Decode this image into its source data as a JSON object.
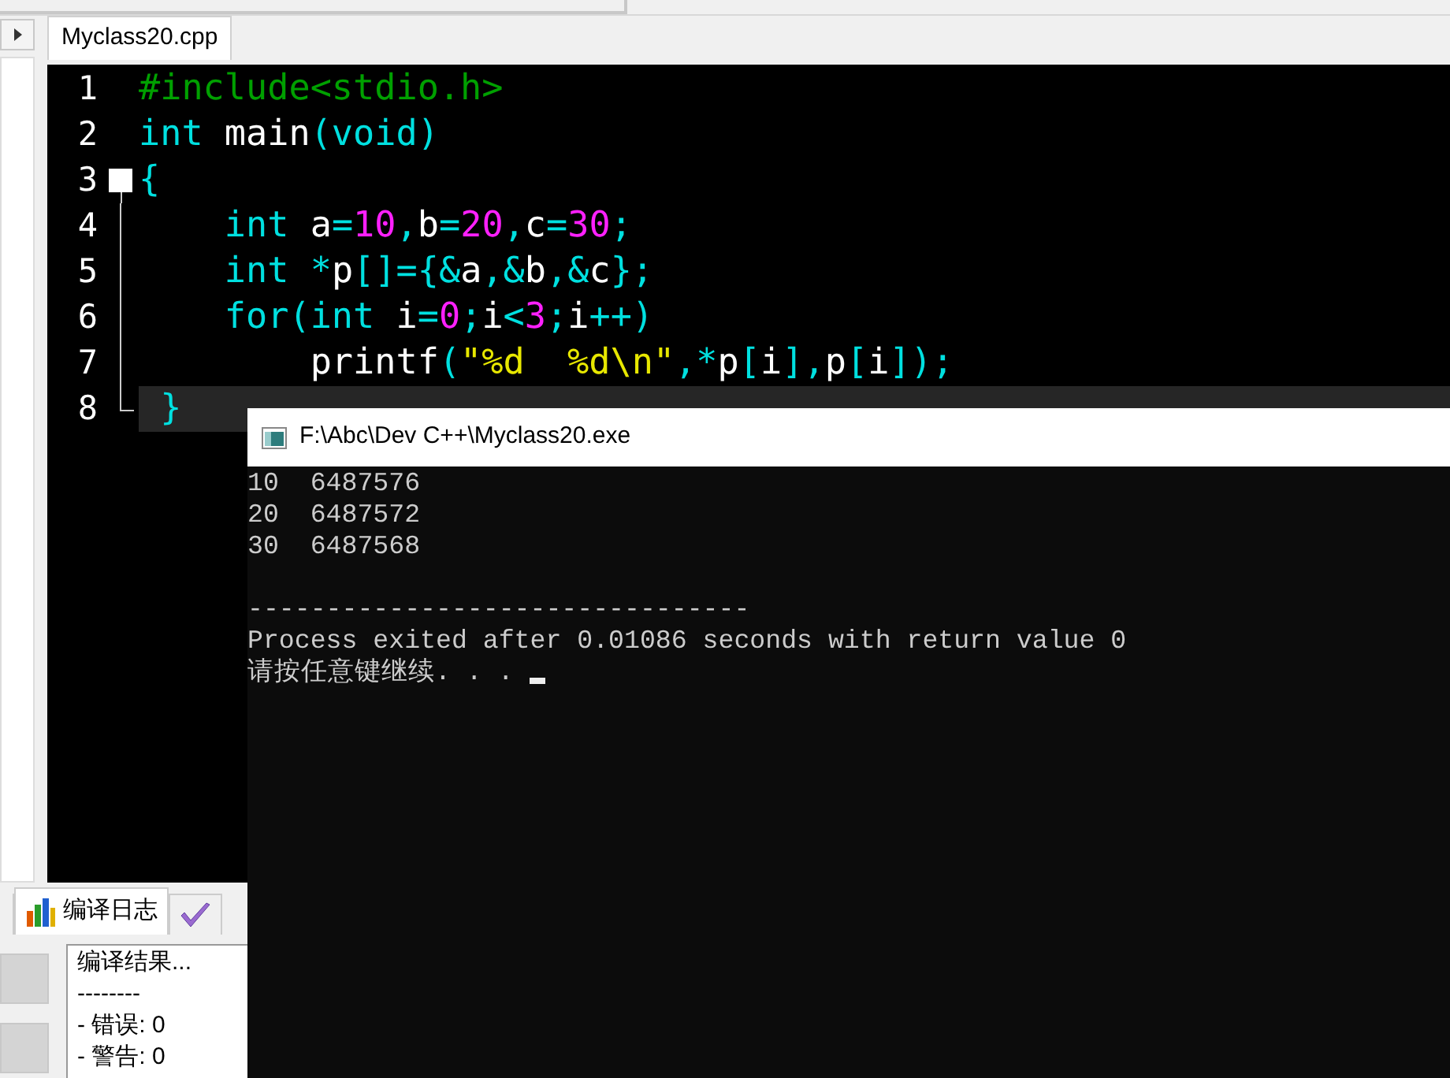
{
  "editor_tabs": [
    {
      "label": "Myclass20.cpp",
      "selected": true
    }
  ],
  "code_lines": [
    {
      "number": "1",
      "kind": "plain",
      "tokens": [
        {
          "text": "#include<stdio.h>",
          "kind": "pre"
        }
      ]
    },
    {
      "number": "2",
      "kind": "plain",
      "tokens": [
        {
          "text": "int",
          "kind": "kw"
        },
        {
          "text": " main",
          "kind": "id"
        },
        {
          "text": "(void)",
          "kind": "kw"
        }
      ]
    },
    {
      "number": "3",
      "kind": "fold_start",
      "tokens": [
        {
          "text": "{",
          "kind": "sym"
        }
      ]
    },
    {
      "number": "4",
      "kind": "in_fold",
      "tokens": [
        {
          "text": "    int",
          "kind": "kw"
        },
        {
          "text": " a",
          "kind": "id"
        },
        {
          "text": "=",
          "kind": "sym"
        },
        {
          "text": "10",
          "kind": "num"
        },
        {
          "text": ",",
          "kind": "sym"
        },
        {
          "text": "b",
          "kind": "id"
        },
        {
          "text": "=",
          "kind": "sym"
        },
        {
          "text": "20",
          "kind": "num"
        },
        {
          "text": ",",
          "kind": "sym"
        },
        {
          "text": "c",
          "kind": "id"
        },
        {
          "text": "=",
          "kind": "sym"
        },
        {
          "text": "30",
          "kind": "num"
        },
        {
          "text": ";",
          "kind": "sym"
        }
      ]
    },
    {
      "number": "5",
      "kind": "in_fold",
      "tokens": [
        {
          "text": "    int",
          "kind": "kw"
        },
        {
          "text": " *",
          "kind": "sym"
        },
        {
          "text": "p",
          "kind": "id"
        },
        {
          "text": "[]={&",
          "kind": "sym"
        },
        {
          "text": "a",
          "kind": "id"
        },
        {
          "text": ",&",
          "kind": "sym"
        },
        {
          "text": "b",
          "kind": "id"
        },
        {
          "text": ",&",
          "kind": "sym"
        },
        {
          "text": "c",
          "kind": "id"
        },
        {
          "text": "};",
          "kind": "sym"
        }
      ]
    },
    {
      "number": "6",
      "kind": "in_fold",
      "tokens": [
        {
          "text": "    for(int",
          "kind": "kw"
        },
        {
          "text": " i",
          "kind": "id"
        },
        {
          "text": "=",
          "kind": "sym"
        },
        {
          "text": "0",
          "kind": "num"
        },
        {
          "text": ";",
          "kind": "sym"
        },
        {
          "text": "i",
          "kind": "id"
        },
        {
          "text": "<",
          "kind": "sym"
        },
        {
          "text": "3",
          "kind": "num"
        },
        {
          "text": ";",
          "kind": "sym"
        },
        {
          "text": "i",
          "kind": "id"
        },
        {
          "text": "++)",
          "kind": "sym"
        }
      ]
    },
    {
      "number": "7",
      "kind": "in_fold",
      "tokens": [
        {
          "text": "        printf",
          "kind": "id"
        },
        {
          "text": "(",
          "kind": "sym"
        },
        {
          "text": "\"%d  %d\\n\"",
          "kind": "str"
        },
        {
          "text": ",*",
          "kind": "sym"
        },
        {
          "text": "p",
          "kind": "id"
        },
        {
          "text": "[",
          "kind": "sym"
        },
        {
          "text": "i",
          "kind": "id"
        },
        {
          "text": "],",
          "kind": "sym"
        },
        {
          "text": "p",
          "kind": "id"
        },
        {
          "text": "[",
          "kind": "sym"
        },
        {
          "text": "i",
          "kind": "id"
        },
        {
          "text": "]);",
          "kind": "sym"
        }
      ]
    },
    {
      "number": "8",
      "kind": "fold_end",
      "current": true,
      "tokens": [
        {
          "text": " }",
          "kind": "sym"
        }
      ]
    }
  ],
  "bottom_tabs": [
    {
      "label": "编译日志",
      "kind": "chart",
      "selected": true
    },
    {
      "kind": "check",
      "selected": false
    }
  ],
  "compile_log": [
    "编译结果...",
    "--------",
    "- 错误: 0",
    "- 警告: 0"
  ],
  "console": {
    "title": "F:\\Abc\\Dev C++\\Myclass20.exe",
    "program_output": [
      "10  6487576",
      "20  6487572",
      "30  6487568"
    ],
    "exit_message": [
      "--------------------------------",
      "Process exited after 0.01086 seconds with return value 0",
      "请按任意键继续. . . "
    ]
  }
}
